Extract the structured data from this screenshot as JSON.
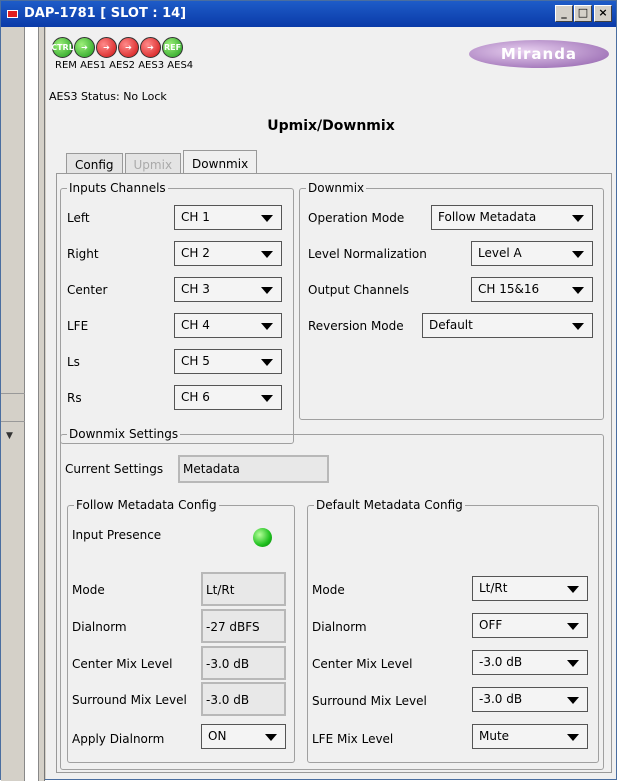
{
  "window": {
    "title": "DAP-1781 [ SLOT : 14]",
    "btn_minimize": "_",
    "btn_maximize": "□",
    "btn_close": "×"
  },
  "status": {
    "icons": [
      {
        "id": "ctrl",
        "text": "CTRL",
        "color": "green"
      },
      {
        "id": "aes1",
        "text": "",
        "color": "green"
      },
      {
        "id": "aes2",
        "text": "",
        "color": "red"
      },
      {
        "id": "aes3",
        "text": "",
        "color": "red"
      },
      {
        "id": "aes4",
        "text": "",
        "color": "red"
      },
      {
        "id": "ref",
        "text": "REF",
        "color": "green"
      }
    ],
    "labels": [
      "REM",
      "AES1",
      "AES2",
      "AES3",
      "AES4"
    ],
    "aes3_status": "AES3 Status: No Lock",
    "logo": "Miranda"
  },
  "page_heading": "Upmix/Downmix",
  "tabs": [
    {
      "label": "Config",
      "state": "normal"
    },
    {
      "label": "Upmix",
      "state": "disabled"
    },
    {
      "label": "Downmix",
      "state": "active"
    }
  ],
  "inputs_channels": {
    "title": "Inputs Channels",
    "rows": [
      {
        "label": "Left",
        "value": "CH 1"
      },
      {
        "label": "Right",
        "value": "CH 2"
      },
      {
        "label": "Center",
        "value": "CH 3"
      },
      {
        "label": "LFE",
        "value": "CH 4"
      },
      {
        "label": "Ls",
        "value": "CH 5"
      },
      {
        "label": "Rs",
        "value": "CH 6"
      }
    ]
  },
  "downmix": {
    "title": "Downmix",
    "rows": [
      {
        "label": "Operation Mode",
        "value": "Follow Metadata"
      },
      {
        "label": "Level Normalization",
        "value": "Level A"
      },
      {
        "label": "Output Channels",
        "value": "CH 15&16"
      },
      {
        "label": "Reversion Mode",
        "value": "Default"
      }
    ]
  },
  "downmix_settings": {
    "title": "Downmix Settings",
    "current_label": "Current Settings",
    "current_value": "Metadata",
    "follow": {
      "title": "Follow Metadata Config",
      "input_presence": "Input Presence",
      "rows": [
        {
          "label": "Mode",
          "value": "Lt/Rt"
        },
        {
          "label": "Dialnorm",
          "value": "-27 dBFS"
        },
        {
          "label": "Center Mix Level",
          "value": "-3.0 dB"
        },
        {
          "label": "Surround Mix Level",
          "value": "-3.0 dB"
        }
      ],
      "apply_label": "Apply Dialnorm",
      "apply_value": "ON"
    },
    "default": {
      "title": "Default Metadata Config",
      "rows": [
        {
          "label": "Mode",
          "value": "Lt/Rt"
        },
        {
          "label": "Dialnorm",
          "value": "OFF"
        },
        {
          "label": "Center Mix Level",
          "value": "-3.0 dB"
        },
        {
          "label": "Surround Mix Level",
          "value": "-3.0 dB"
        },
        {
          "label": "LFE Mix Level",
          "value": "Mute"
        }
      ]
    }
  }
}
